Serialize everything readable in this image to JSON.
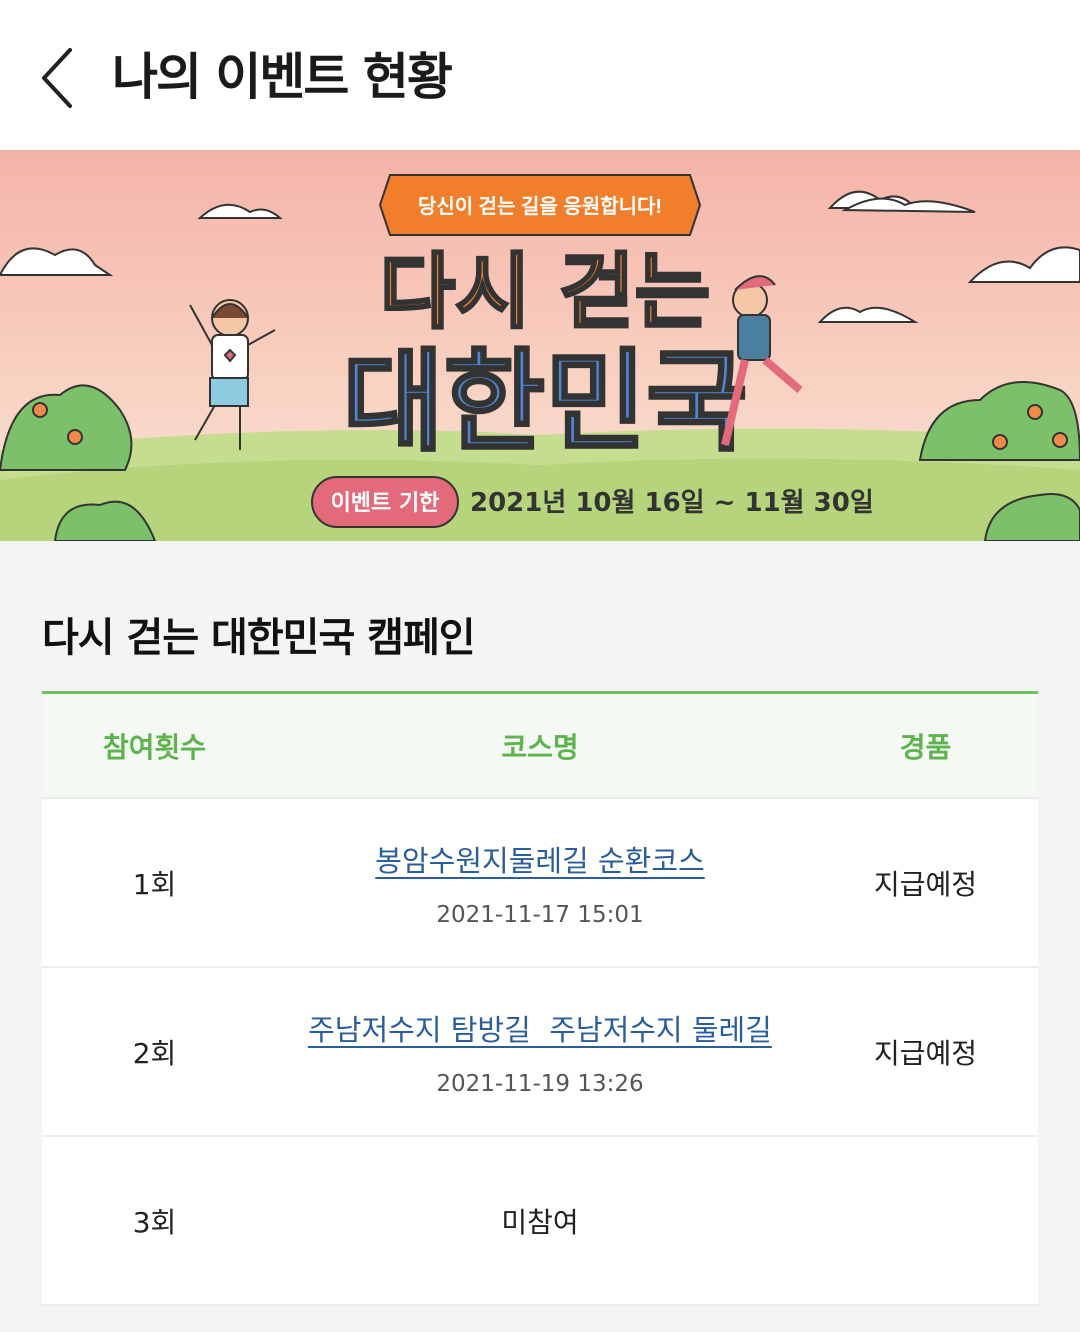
{
  "header": {
    "title": "나의 이벤트 현황",
    "back_icon": "chevron-left-icon"
  },
  "banner": {
    "ribbon_text": "당신이 걷는 길을 응원합니다!",
    "headline_top": "다시 걷는",
    "headline_bottom": "대한민국",
    "period_label": "이벤트 기한",
    "period_value": "2021년 10월 16일 ~ 11월 30일"
  },
  "campaign": {
    "title": "다시 걷는 대한민국 캠페인"
  },
  "table": {
    "columns": [
      "참여횟수",
      "코스명",
      "경품"
    ],
    "rows": [
      {
        "count": "1회",
        "course": "봉암수원지둘레길 순환코스",
        "date": "2021-11-17 15:01",
        "prize": "지급예정"
      },
      {
        "count": "2회",
        "course": "주남저수지 탐방길  주남저수지 둘레길",
        "date": "2021-11-19 13:26",
        "prize": "지급예정"
      },
      {
        "count": "3회",
        "status": "미참여",
        "prize": ""
      }
    ]
  },
  "colors": {
    "accent_green": "#5fb34f",
    "link_blue": "#2a5d9c",
    "banner_orange": "#f07e2a",
    "banner_blue": "#4f86d4",
    "banner_pink": "#e26a7a"
  }
}
